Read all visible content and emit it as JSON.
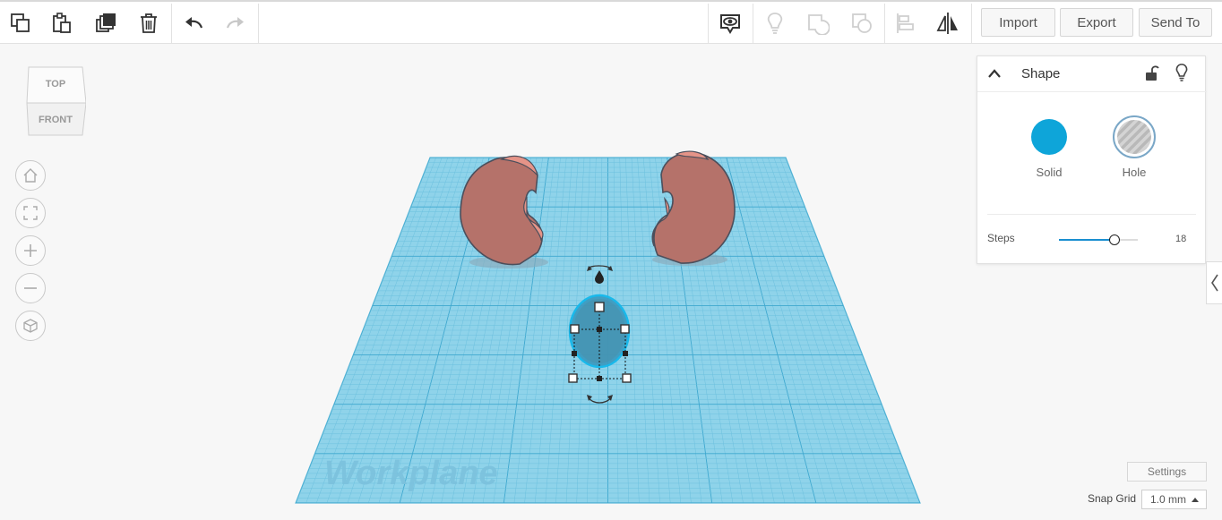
{
  "toolbar": {
    "buttons": [
      {
        "name": "copy",
        "icon": "copy-icon"
      },
      {
        "name": "paste",
        "icon": "paste-icon"
      },
      {
        "name": "duplicate",
        "icon": "duplicate-icon"
      },
      {
        "name": "delete",
        "icon": "trash-icon"
      },
      {
        "name": "undo",
        "icon": "undo-icon"
      },
      {
        "name": "redo",
        "icon": "redo-icon"
      },
      {
        "name": "show-all",
        "icon": "eye-bubble-icon"
      },
      {
        "name": "hint",
        "icon": "lightbulb-icon"
      },
      {
        "name": "group",
        "icon": "group-icon"
      },
      {
        "name": "ungroup",
        "icon": "ungroup-icon"
      },
      {
        "name": "align",
        "icon": "align-icon"
      },
      {
        "name": "mirror",
        "icon": "mirror-icon"
      }
    ],
    "import_label": "Import",
    "export_label": "Export",
    "send_to_label": "Send To"
  },
  "viewcube": {
    "top_label": "TOP",
    "front_label": "FRONT"
  },
  "nav": [
    {
      "name": "home-view",
      "icon": "home-icon"
    },
    {
      "name": "fit-view",
      "icon": "fit-frame-icon"
    },
    {
      "name": "zoom-in",
      "icon": "plus-icon"
    },
    {
      "name": "zoom-out",
      "icon": "minus-icon"
    },
    {
      "name": "perspective",
      "icon": "cube-icon"
    }
  ],
  "workplane": {
    "label": "Workplane",
    "color": "#8fd3ea"
  },
  "shape_panel": {
    "title": "Shape",
    "solid_label": "Solid",
    "hole_label": "Hole",
    "solid_color": "#0ea5d9",
    "steps_label": "Steps",
    "steps_value": "18",
    "steps_fraction": 0.7
  },
  "settings_label": "Settings",
  "snap_grid": {
    "label": "Snap Grid",
    "value": "1.0 mm"
  },
  "objects": {
    "shape_color": "#b5726a"
  }
}
